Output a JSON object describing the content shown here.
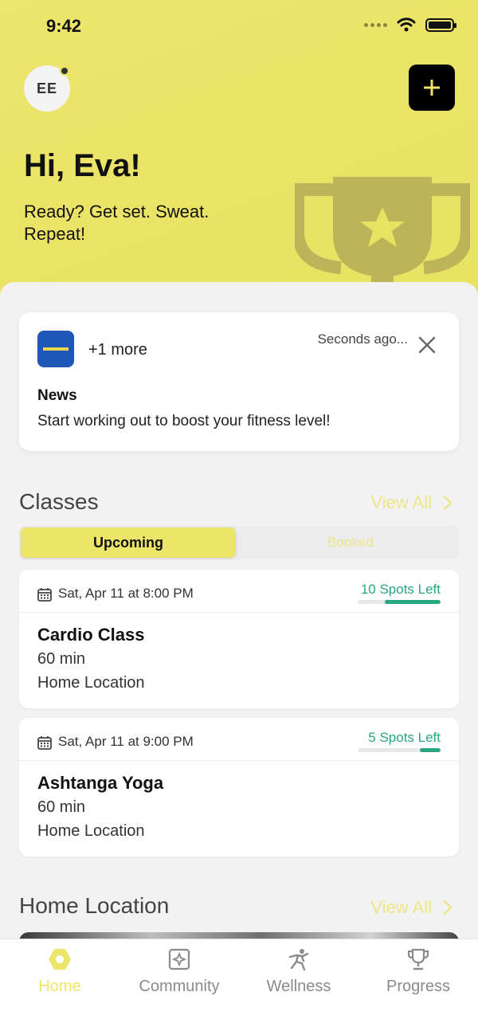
{
  "status_bar": {
    "time": "9:42"
  },
  "header": {
    "avatar_initials": "EE",
    "greeting": "Hi, Eva!",
    "tagline": "Ready? Get set. Sweat. Repeat!"
  },
  "news": {
    "more": "+1 more",
    "time": "Seconds ago...",
    "title": "News",
    "body": "Start working out to boost your fitness level!"
  },
  "classes": {
    "title": "Classes",
    "view_all": "View All",
    "tabs": {
      "upcoming": "Upcoming",
      "booked": "Booked"
    },
    "items": [
      {
        "date": "Sat, Apr 11 at 8:00 PM",
        "spots": "10 Spots Left",
        "spots_fill": 0.67,
        "name": "Cardio Class",
        "duration": "60 min",
        "location": "Home Location"
      },
      {
        "date": "Sat, Apr 11 at 9:00 PM",
        "spots": "5 Spots Left",
        "spots_fill": 0.25,
        "name": "Ashtanga Yoga",
        "duration": "60 min",
        "location": "Home Location"
      }
    ]
  },
  "home_location": {
    "title": "Home Location",
    "view_all": "View All"
  },
  "tabbar": {
    "items": [
      {
        "label": "Home",
        "icon": "home-icon"
      },
      {
        "label": "Community",
        "icon": "community-icon"
      },
      {
        "label": "Wellness",
        "icon": "wellness-icon"
      },
      {
        "label": "Progress",
        "icon": "trophy-icon"
      }
    ]
  },
  "colors": {
    "accent": "#ECE56A",
    "spots": "#2AA581",
    "hero": "#E9E160",
    "trophy": "#BDB45A"
  }
}
